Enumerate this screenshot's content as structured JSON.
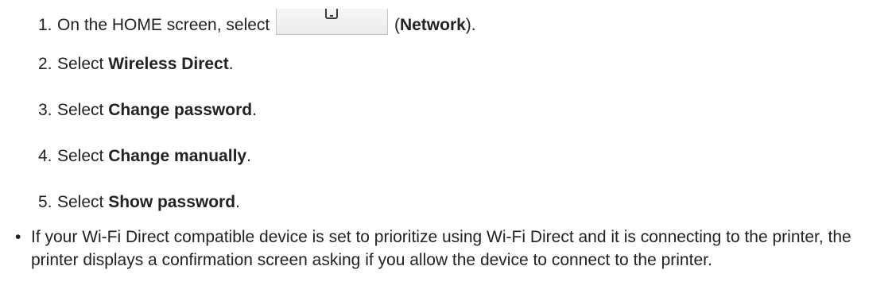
{
  "steps": [
    {
      "number": "1.",
      "before": "On the HOME screen, select ",
      "icon": "tablet-network-icon",
      "after_open": " (",
      "bold": "Network",
      "after_close": ")."
    },
    {
      "number": "2.",
      "before": "Select ",
      "bold": "Wireless Direct",
      "after": "."
    },
    {
      "number": "3.",
      "before": "Select ",
      "bold": "Change password",
      "after": "."
    },
    {
      "number": "4.",
      "before": "Select ",
      "bold": "Change manually",
      "after": "."
    },
    {
      "number": "5.",
      "before": "Select ",
      "bold": "Show password",
      "after": "."
    }
  ],
  "note": {
    "bullet": "•",
    "text": "If your Wi-Fi Direct compatible device is set to prioritize using Wi-Fi Direct and it is connecting to the printer, the printer displays a confirmation screen asking if you allow the device to connect to the printer."
  }
}
